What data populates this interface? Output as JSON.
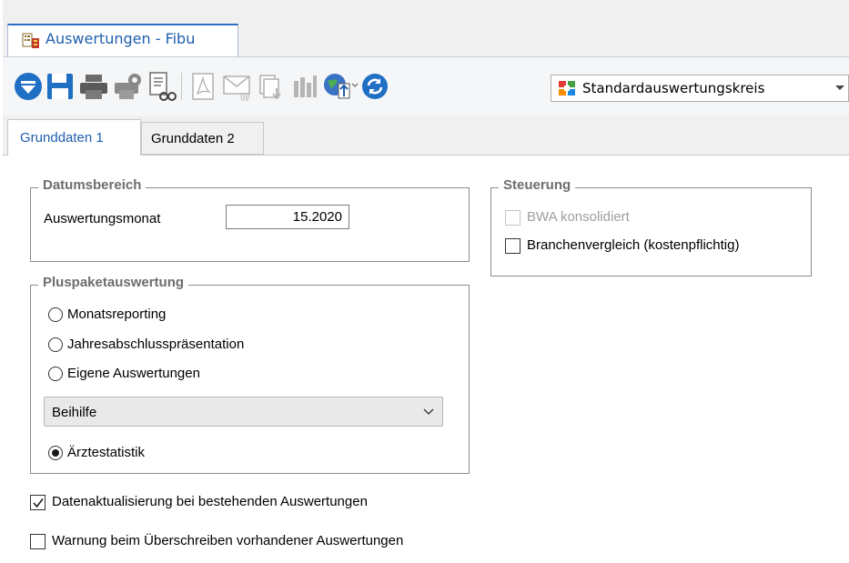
{
  "window": {
    "doc_tab_label": "Auswertungen - Fibu"
  },
  "toolbar": {
    "buttons": [
      "menu-down-icon",
      "save-icon",
      "print-icon",
      "print-settings-icon",
      "print-preview-icon",
      "pdf-icon",
      "email-icon",
      "export-icon",
      "chart-icon",
      "web-upload-icon",
      "refresh-icon"
    ],
    "circle_selector_value": "Standardauswertungskreis"
  },
  "tabs": {
    "tab1": "Grunddaten 1",
    "tab2": "Grunddaten 2"
  },
  "datumsbereich": {
    "title": "Datumsbereich",
    "month_label": "Auswertungsmonat",
    "month_value": "15.2020"
  },
  "steuerung": {
    "title": "Steuerung",
    "bwa_label": "BWA konsolidiert",
    "branchen_label": "Branchenvergleich (kostenpflichtig)"
  },
  "pluspaket": {
    "title": "Pluspaketauswertung",
    "option1": "Monatsreporting",
    "option2": "Jahresabschlusspräsentation",
    "option3": "Eigene Auswertungen",
    "dropdown_value": "Beihilfe",
    "option4": "Ärztestatistik",
    "selected": "Ärztestatistik"
  },
  "options": {
    "update_label": "Datenaktualisierung bei bestehenden Auswertungen",
    "update_checked": true,
    "warn_label": "Warnung beim Überschreiben vorhandener Auswertungen",
    "warn_checked": false
  },
  "colors": {
    "accent": "#1f5fae",
    "group_title": "#6d6d6d"
  }
}
